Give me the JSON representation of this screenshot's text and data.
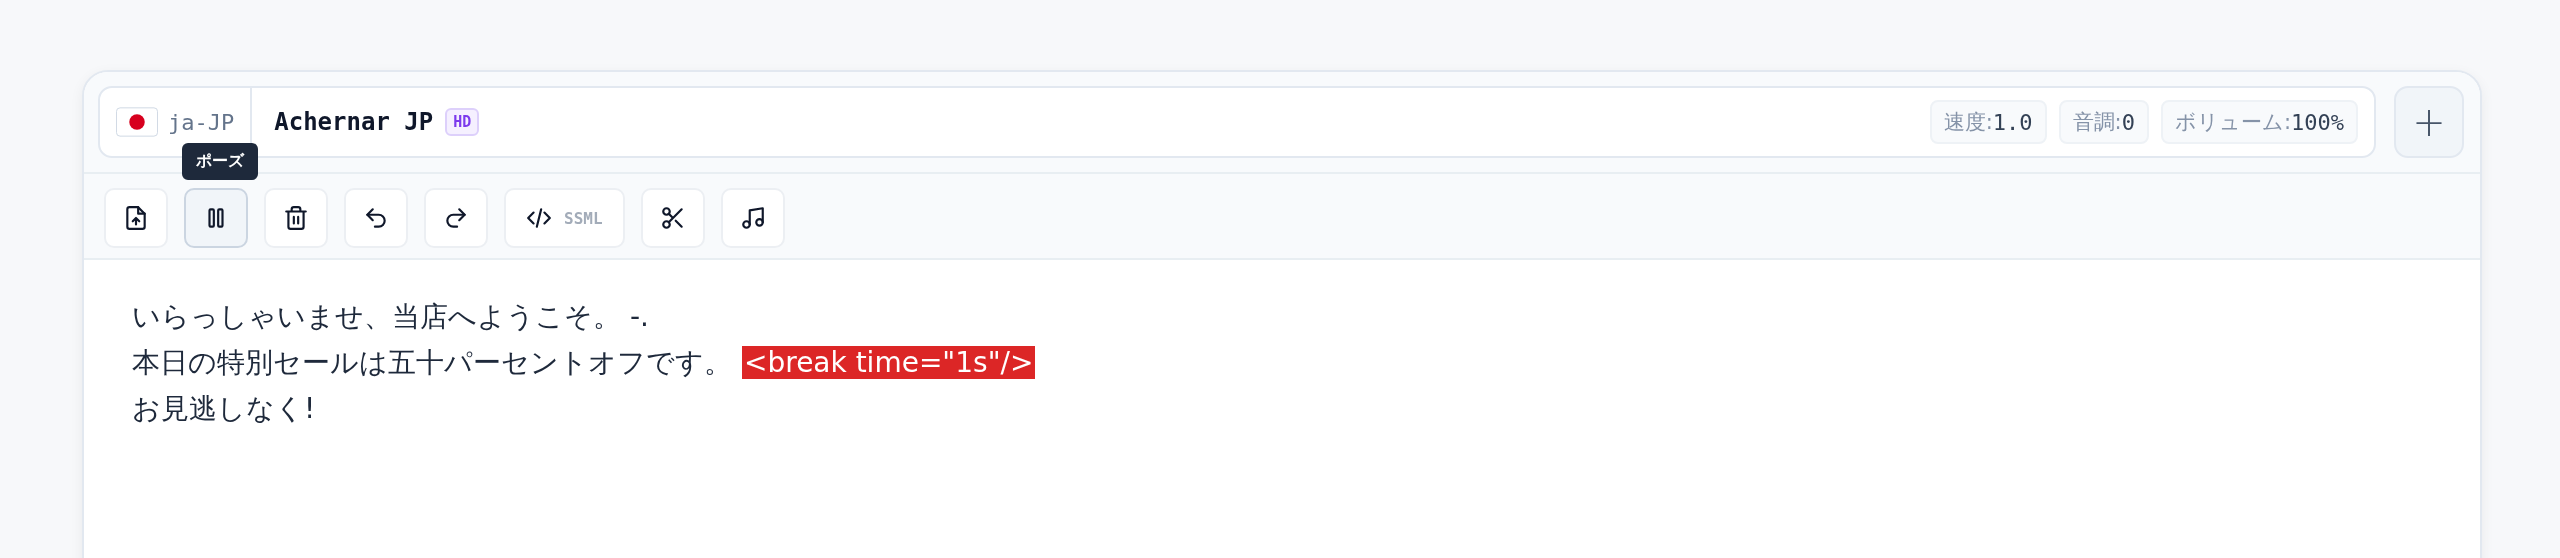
{
  "header": {
    "locale": "ja-JP",
    "voice": "Achernar JP",
    "badge": "HD",
    "params": [
      {
        "label": "速度:",
        "value": "1.0"
      },
      {
        "label": "音調:",
        "value": "0"
      },
      {
        "label": "ボリューム:",
        "value": "100%"
      }
    ],
    "add_button": "+"
  },
  "toolbar": {
    "tooltip": "ポーズ",
    "tools": [
      {
        "kind": "upload",
        "selected": false
      },
      {
        "kind": "pause",
        "selected": true
      },
      {
        "kind": "trash",
        "selected": false
      },
      {
        "kind": "undo",
        "selected": false
      },
      {
        "kind": "redo",
        "selected": false
      },
      {
        "kind": "code",
        "selected": false,
        "label": "SSML"
      },
      {
        "kind": "cut",
        "selected": false
      },
      {
        "kind": "music",
        "selected": false
      }
    ]
  },
  "editor": {
    "lines": [
      [
        {
          "text": "いらっしゃいませ、当店へようこそ。 -.",
          "highlighted": false
        }
      ],
      [
        {
          "text": "本日の特別セールは五十パーセントオフです。",
          "highlighted": false
        },
        {
          "text": "<break time=\"1s\"/>",
          "highlighted": true
        }
      ],
      [
        {
          "text": "お見逃しなく!",
          "highlighted": false
        }
      ]
    ]
  }
}
